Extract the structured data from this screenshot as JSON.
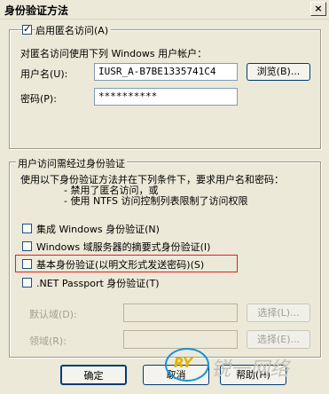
{
  "window": {
    "title": "身份验证方法",
    "close_glyph": "×"
  },
  "anonymous": {
    "checkbox_label": "启用匿名访问(A)",
    "checked": true,
    "description": "对匿名访问使用下列 Windows 用户帐户：",
    "username_label": "用户名(U):",
    "username_value": "IUSR_A-B7BE1335741C4",
    "browse_button": "浏览(B)...",
    "password_label": "密码(P):",
    "password_value": "**********"
  },
  "authenticated": {
    "legend": "用户访问需经过身份验证",
    "description_line1": "使用以下身份验证方法并在下列条件下，要求用户名和密码：",
    "description_line2": "- 禁用了匿名访问，或",
    "description_line3": "- 使用 NTFS 访问控制列表限制了访问权限",
    "options": [
      {
        "label": "集成 Windows 身份验证(N)",
        "checked": false
      },
      {
        "label": "Windows 域服务器的摘要式身份验证(I)",
        "checked": false
      },
      {
        "label": "基本身份验证(以明文形式发送密码)(S)",
        "checked": false
      },
      {
        "label": ".NET Passport 身份验证(T)",
        "checked": false
      }
    ],
    "default_domain_label": "默认域(D):",
    "realm_label": "领域(R):",
    "select_button_1": "选择(L)...",
    "select_button_2": "选择(E)..."
  },
  "footer": {
    "ok": "确定",
    "cancel": "取消",
    "help": "帮助(H)"
  },
  "watermark": {
    "logo": "RY",
    "text": "锐一网络"
  }
}
